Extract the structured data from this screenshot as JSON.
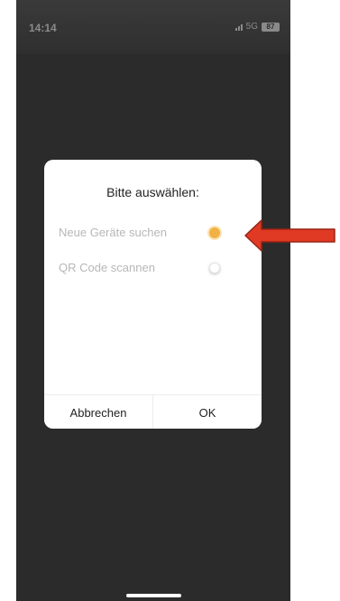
{
  "status_bar": {
    "time": "14:14",
    "network": "5G",
    "battery": "87"
  },
  "dialog": {
    "title": "Bitte auswählen:",
    "options": [
      {
        "label": "Neue Geräte suchen",
        "selected": true
      },
      {
        "label": "QR Code scannen",
        "selected": false
      }
    ],
    "cancel_label": "Abbrechen",
    "ok_label": "OK"
  },
  "annotation": {
    "arrow_color": "#e03a24",
    "arrow_outline": "#9a2313"
  },
  "colors": {
    "accent": "#f2b144",
    "overlay": "#2b2b2b"
  }
}
